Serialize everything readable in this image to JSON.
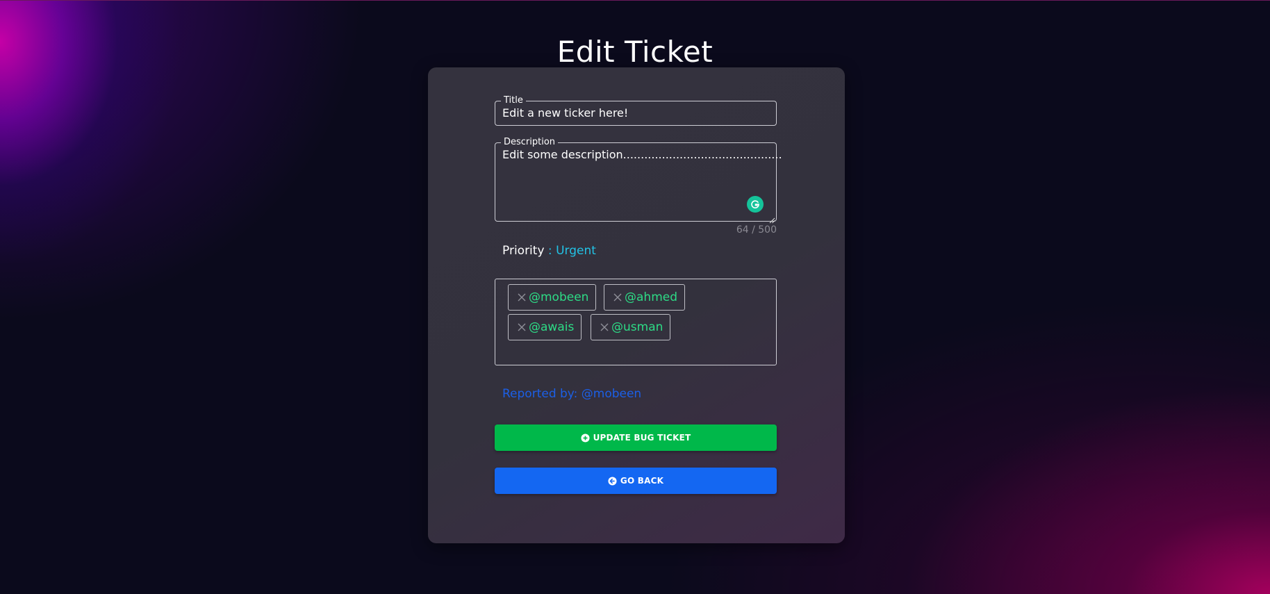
{
  "page": {
    "title": "Edit Ticket"
  },
  "form": {
    "title_field": {
      "label": "Title",
      "value": "Edit a new ticker here!"
    },
    "description_field": {
      "label": "Description",
      "value": "Edit some description.............................................",
      "char_counter": "64 / 500"
    },
    "priority": {
      "label": "Priority",
      "separator": " : ",
      "value": "Urgent"
    },
    "assignees": [
      {
        "label": "@mobeen",
        "icon": "close-icon"
      },
      {
        "label": "@ahmed",
        "icon": "close-icon"
      },
      {
        "label": "@awais",
        "icon": "close-icon"
      },
      {
        "label": "@usman",
        "icon": "close-icon"
      }
    ],
    "reported_by": "Reported by: @mobeen",
    "update_button": {
      "label": "UPDATE BUG TICKET",
      "icon": "plus-circle-icon"
    },
    "back_button": {
      "label": "GO BACK",
      "icon": "arrow-left-circle-icon"
    }
  },
  "colors": {
    "update_button": "#00b84a",
    "back_button": "#1467f2",
    "tag_text": "#2ddc86",
    "priority_value": "#22c3e6",
    "reported_by": "#1c5fe6",
    "grammarly": "#15c39a"
  }
}
